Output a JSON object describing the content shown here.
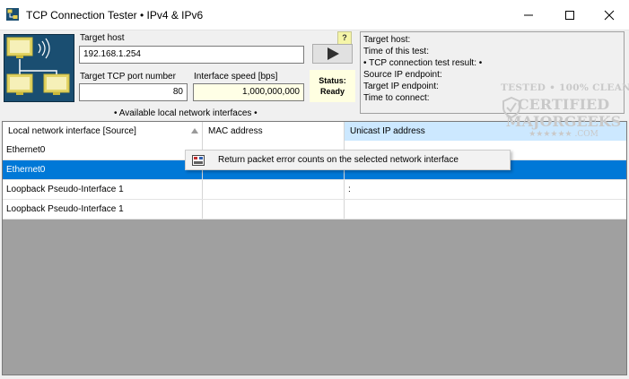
{
  "window": {
    "title": "TCP Connection Tester • IPv4 & IPv6",
    "icons": {
      "app": "network-app-icon",
      "minimize": "minimize-icon",
      "maximize": "maximize-icon",
      "close": "close-icon"
    }
  },
  "form": {
    "target_host_label": "Target host",
    "target_host_value": "192.168.1.254",
    "port_label": "Target TCP port number",
    "port_value": "80",
    "speed_label": "Interface speed [bps]",
    "speed_value": "1,000,000,000",
    "help_label": "?",
    "run_icon": "play-icon",
    "status_label": "Status:",
    "status_value": "Ready"
  },
  "results": {
    "lines": [
      "Target host:",
      "Time of this test:",
      "• TCP connection test result: •",
      "Source IP endpoint:",
      "Target IP endpoint:",
      "Time to connect:"
    ]
  },
  "interfaces": {
    "caption": "• Available local network interfaces •",
    "columns": [
      "Local network interface [Source]",
      "MAC address",
      "Unicast IP address"
    ],
    "rows": [
      {
        "name": "Ethernet0",
        "mac": "",
        "ip": "",
        "mac_obscured": "",
        "ip_obscured": ""
      },
      {
        "name": "Ethernet0",
        "mac": "",
        "ip": "",
        "mac_obscured": "",
        "ip_obscured": ""
      },
      {
        "name": "Loopback Pseudo-Interface 1",
        "mac": "",
        "ip": ":",
        "mac_obscured": "",
        "ip_obscured": ""
      },
      {
        "name": "Loopback Pseudo-Interface 1",
        "mac": "",
        "ip": "",
        "mac_obscured": "",
        "ip_obscured": ""
      }
    ],
    "selected_row": 1
  },
  "context_menu": {
    "icon": "packet-error-icon",
    "label": "Return packet error counts on the selected network interface"
  },
  "watermark": {
    "line1": "TESTED • 100% CLEAN",
    "line2": "CERTIFIED",
    "line3": "MAJORGEEKS",
    "line4": "★★★★★★ .COM"
  },
  "colors": {
    "selection": "#0078d7",
    "header_highlight": "#cce8ff",
    "status_bg": "#ffffe1",
    "grid_bg": "#a0a0a0"
  }
}
